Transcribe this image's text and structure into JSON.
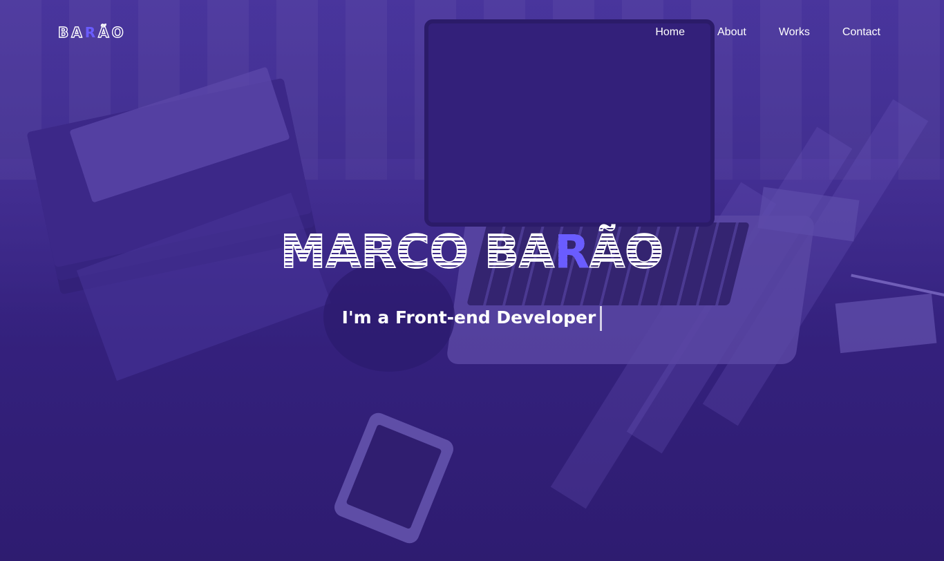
{
  "brand": {
    "logo_parts": [
      "BA",
      "R",
      "ÃO"
    ],
    "accent_color": "#6a5cff"
  },
  "nav": {
    "items": [
      {
        "label": "Home"
      },
      {
        "label": "About"
      },
      {
        "label": "Works"
      },
      {
        "label": "Contact"
      }
    ]
  },
  "hero": {
    "title_parts": [
      "MARCO BA",
      "R",
      "ÃO"
    ],
    "subtitle": "I'm a Front-end Developer",
    "overlay_color": "#3c238c"
  }
}
